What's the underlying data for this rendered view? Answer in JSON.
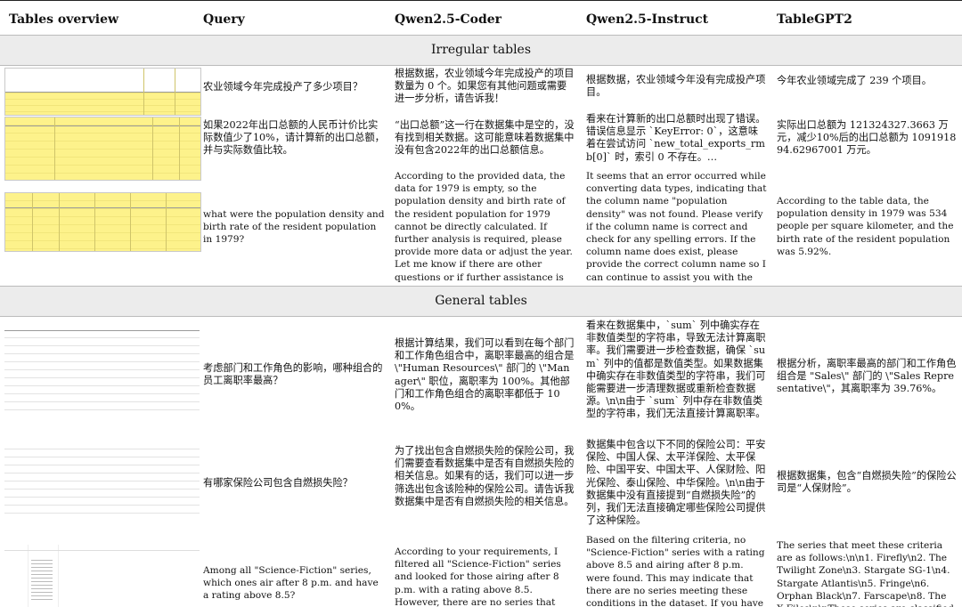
{
  "header": {
    "col_tables": "Tables overview",
    "col_query": "Query",
    "col_coder": "Qwen2.5-Coder",
    "col_instruct": "Qwen2.5-Instruct",
    "col_tablegpt": "TableGPT2"
  },
  "sections": {
    "irregular": "Irregular tables",
    "general": "General tables"
  },
  "rows": [
    {
      "query": "农业领域今年完成投产了多少项目？",
      "coder": "根据数据，农业领域今年完成投产的项目数量为 0 个。如果您有其他问题或需要进一步分析，请告诉我！",
      "instruct": "根据数据，农业领域今年没有完成投产项目。",
      "tablegpt": "今年农业领域完成了 239 个项目。"
    },
    {
      "query": "如果2022年出口总额的人民币计价比实际数值少了10%，请计算新的出口总额，并与实际数值比较。",
      "coder": "“出口总额”这一行在数据集中是空的，没有找到相关数据。这可能意味着数据集中没有包含2022年的出口总额信息。",
      "instruct": "看来在计算新的出口总额时出现了错误。错误信息显示 `KeyError: 0`，这意味着在尝试访问 `new_total_exports_rmb[0]` 时，索引 0 不存在。…",
      "tablegpt": "实际出口总额为 121324327.3663 万元，减少10%后的出口总额为 109191894.62967001 万元。"
    },
    {
      "query": "what were the population density and birth rate of the resident population in 1979?",
      "coder": "According to the provided data, the data for 1979 is empty, so the population density and birth rate of the resident population for 1979 cannot be directly calculated. If further analysis is required, please provide more data or adjust the year. Let me know if there are other questions or if further assistance is needed.",
      "instruct": "It seems that an error occurred while converting data types, indicating that the column name \"population density\" was not found. Please verify if the column name is correct and check for any spelling errors. If the column name does exist, please provide the correct column name so I can continue to assist you with the data analysis.",
      "tablegpt": "According to the table data, the population density in 1979 was 534 people per square kilometer, and the birth rate of the resident population was 5.92%."
    },
    {
      "query": "考虑部门和工作角色的影响，哪种组合的员工离职率最高？",
      "coder": "根据计算结果，我们可以看到在每个部门和工作角色组合中，离职率最高的组合是 \\\"Human Resources\\\" 部门的 \\\"Manager\\\" 职位，离职率为 100%。其他部门和工作角色组合的离职率都低于 100%。",
      "instruct": "看来在数据集中，`sum` 列中确实存在非数值类型的字符串，导致无法计算离职率。我们需要进一步检查数据，确保 `sum` 列中的值都是数值类型。如果数据集中确实存在非数值类型的字符串，我们可能需要进一步清理数据或重新检查数据源。\\n\\n由于 `sum` 列中存在非数值类型的字符串，我们无法直接计算离职率。",
      "tablegpt": "根据分析，离职率最高的部门和工作角色组合是 \"Sales\\\" 部门的 \\\"Sales Representative\\\"，其离职率为 39.76%。"
    },
    {
      "query": "有哪家保险公司包含自燃损失险？",
      "coder": "为了找出包含自燃损失险的保险公司，我们需要查看数据集中是否有自燃损失险的相关信息。如果有的话，我们可以进一步筛选出包含该险种的保险公司。请告诉我数据集中是否有自燃损失险的相关信息。",
      "instruct": "数据集中包含以下不同的保险公司：平安保险、中国人保、太平洋保险、太平保险、中国平安、中国太平、人保财险、阳光保险、泰山保险、中华保险。\\n\\n由于数据集中没有直接提到“自燃损失险”的列，我们无法直接确定哪些保险公司提供了这种保险。",
      "tablegpt": "根据数据集，包含“自燃损失险”的保险公司是“人保财险”。"
    },
    {
      "query": "Among all \"Science-Fiction\" series, which ones air after 8 p.m. and have a rating above 8.5?",
      "coder": "According to your requirements, I filtered all \"Science-Fiction\" series and looked for those airing after 8 p.m. with a rating above 8.5. However, there are no series that meet these criteria based on the data",
      "instruct": "Based on the filtering criteria, no \"Science-Fiction\" series with a rating above 8.5 and airing after 8 p.m. were found. This may indicate that there are no series meeting these conditions in the dataset. If you have other requirements or",
      "tablegpt": "The series that meet these criteria are as follows:\\n\\n1. Firefly\\n2. The Twilight Zone\\n3. Stargate SG-1\\n4. Stargate Atlantis\\n5. Fringe\\n6. Orphan Black\\n7. Farscape\\n8. The X-Files\\n\\nThese series are classified as \"Science-Fiction\" air"
    }
  ]
}
